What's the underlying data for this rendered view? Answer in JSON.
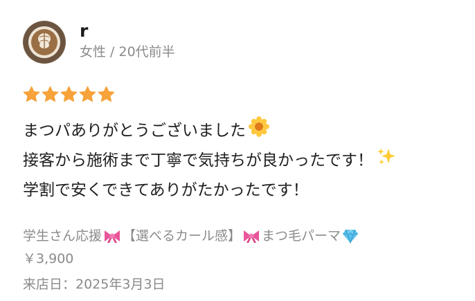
{
  "reviewer": {
    "name": "r",
    "meta": "女性 / 20代前半"
  },
  "rating": {
    "value": 5,
    "max": 5,
    "color": "#F7A23B"
  },
  "review": {
    "line1": "まつパありがとうございました",
    "line2": "接客から施術まで丁寧で気持ちが良かったです！",
    "line3": "学割で安くできてありがたかったです！"
  },
  "menu": {
    "part1": "学生さん応援",
    "part2": "【選べるカール感】",
    "part3": "まつ毛パーマ"
  },
  "price": "￥3,900",
  "visit_date": "来店日：2025年3月3日",
  "icons": {
    "avatar": "latte-art-avatar",
    "flower": "sunflower-emoji",
    "sparkles": "sparkles-emoji",
    "ribbon": "ribbon-emoji",
    "gem": "gem-emoji"
  }
}
